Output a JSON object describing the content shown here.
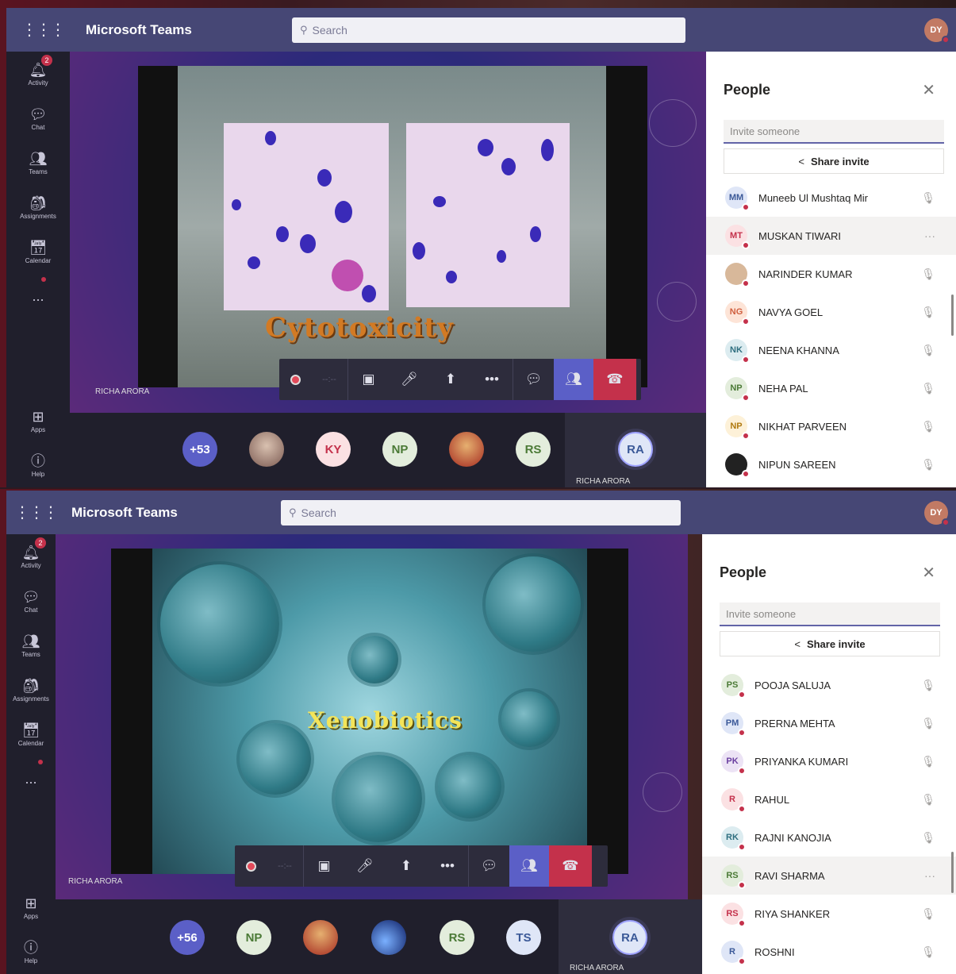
{
  "shared": {
    "app_title": "Microsoft Teams",
    "search_placeholder": "Search",
    "me_initials": "DY",
    "rail": [
      {
        "icon": "bell-icon",
        "label": "Activity",
        "badge": "2"
      },
      {
        "icon": "chat-icon",
        "label": "Chat"
      },
      {
        "icon": "teams-icon",
        "label": "Teams"
      },
      {
        "icon": "assignments-icon",
        "label": "Assignments"
      },
      {
        "icon": "calendar-icon",
        "label": "Calendar"
      }
    ],
    "more_label": "...",
    "apps_label": "Apps",
    "help_label": "Help",
    "panel_title": "People",
    "invite_placeholder": "Invite someone",
    "share_invite_label": "Share invite",
    "speaker_name": "RICHA ARORA",
    "me_tile_initials": "RA",
    "colors": {
      "topbar": "#464775",
      "rail": "#201f2c",
      "accent": "#6264a7",
      "hangup": "#c4314b"
    }
  },
  "frame1": {
    "slide_title": "Cytotoxicity",
    "tray": [
      {
        "label": "+53",
        "kind": "count"
      },
      {
        "label": "",
        "kind": "photo"
      },
      {
        "label": "KY",
        "kind": "initials"
      },
      {
        "label": "NP",
        "kind": "initials"
      },
      {
        "label": "",
        "kind": "photo"
      },
      {
        "label": "RS",
        "kind": "initials"
      }
    ],
    "people": [
      {
        "initials": "MM",
        "name": "Muneeb Ul Mushtaq Mir",
        "color": "#dfe6f7",
        "text": "#3b5998"
      },
      {
        "initials": "MT",
        "name": "MUSKAN TIWARI",
        "color": "#fbe1e3",
        "text": "#c4314b",
        "highlight": true
      },
      {
        "initials": "",
        "name": "NARINDER KUMAR",
        "color": "#d8b89a",
        "text": "#553"
      },
      {
        "initials": "NG",
        "name": "NAVYA GOEL",
        "color": "#fde4d7",
        "text": "#d06040"
      },
      {
        "initials": "NK",
        "name": "NEENA KHANNA",
        "color": "#dcecf0",
        "text": "#2f6f80"
      },
      {
        "initials": "NP",
        "name": "NEHA PAL",
        "color": "#e3eddc",
        "text": "#4b7a36"
      },
      {
        "initials": "NP",
        "name": "NIKHAT PARVEEN",
        "color": "#fdf1d8",
        "text": "#b07a10"
      },
      {
        "initials": "",
        "name": "NIPUN SAREEN",
        "color": "#222",
        "text": "#fff"
      }
    ]
  },
  "frame2": {
    "slide_title": "Xenobiotics",
    "tray": [
      {
        "label": "+56",
        "kind": "count"
      },
      {
        "label": "NP",
        "kind": "initials"
      },
      {
        "label": "",
        "kind": "photo"
      },
      {
        "label": "",
        "kind": "photo-blue"
      },
      {
        "label": "RS",
        "kind": "initials"
      },
      {
        "label": "TS",
        "kind": "initials"
      }
    ],
    "people": [
      {
        "initials": "PS",
        "name": "POOJA SALUJA",
        "color": "#e3eddc",
        "text": "#4b7a36"
      },
      {
        "initials": "PM",
        "name": "PRERNA MEHTA",
        "color": "#dfe6f7",
        "text": "#3b5998"
      },
      {
        "initials": "PK",
        "name": "PRIYANKA KUMARI",
        "color": "#ece3f5",
        "text": "#6a3fa0"
      },
      {
        "initials": "R",
        "name": "RAHUL",
        "color": "#fbe1e3",
        "text": "#c4314b"
      },
      {
        "initials": "RK",
        "name": "RAJNI KANOJIA",
        "color": "#dcecf0",
        "text": "#2f6f80"
      },
      {
        "initials": "RS",
        "name": "RAVI SHARMA",
        "color": "#e3eddc",
        "text": "#4b7a36",
        "highlight": true
      },
      {
        "initials": "RS",
        "name": "RIYA SHANKER",
        "color": "#fbe1e3",
        "text": "#c4314b"
      },
      {
        "initials": "R",
        "name": "ROSHNI",
        "color": "#dfe6f7",
        "text": "#3b5998"
      }
    ]
  }
}
